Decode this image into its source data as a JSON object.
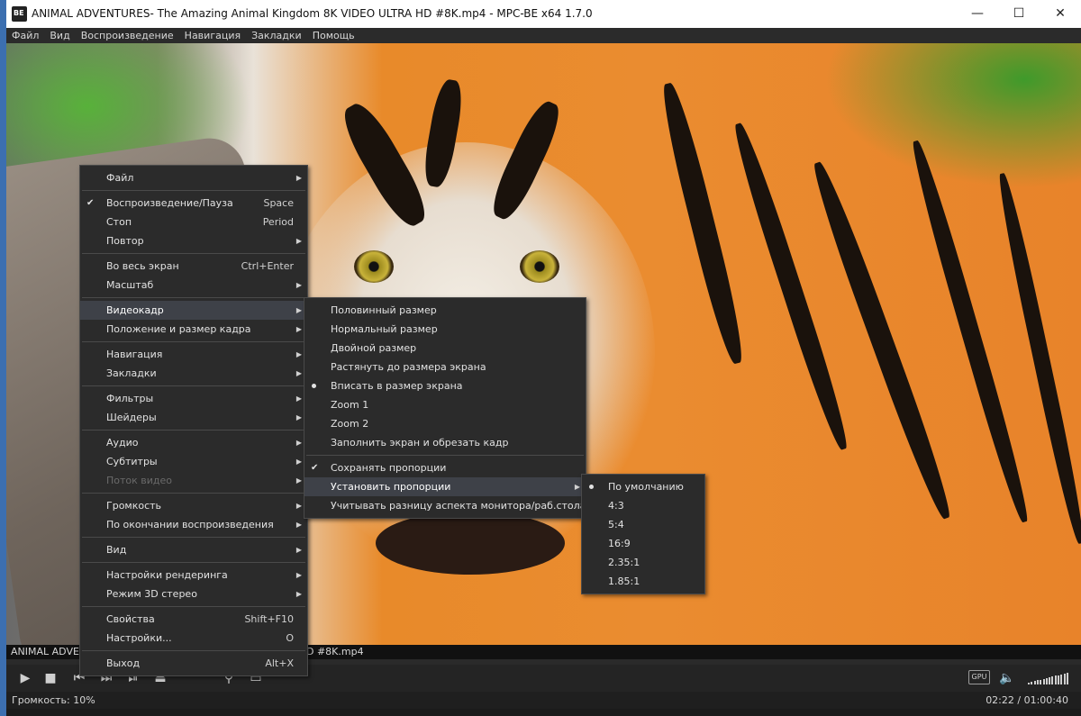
{
  "window": {
    "title": "ANIMAL ADVENTURES- The Amazing Animal Kingdom 8K VIDEO ULTRA HD #8K.mp4 - MPC-BE x64 1.7.0",
    "logo_text": "BE",
    "minimize": "—",
    "maximize": "☐",
    "close": "✕"
  },
  "menubar": [
    "Файл",
    "Вид",
    "Воспроизведение",
    "Навигация",
    "Закладки",
    "Помощь"
  ],
  "overlay": {
    "left_text": "ANIMAL ADVENT",
    "right_text": "D #8K.mp4"
  },
  "controls": {
    "play_icon": "▶",
    "stop_icon": "■",
    "prev_icon": "⏮",
    "next_icon": "⏭",
    "frame_icon": "⏯",
    "eject_icon": "⏏",
    "search_icon": "⚲",
    "misc_icon": "▭",
    "gpu_label": "GPU",
    "volume_icon": "🔈"
  },
  "status": {
    "volume": "Громкость: 10%",
    "time": "02:22 / 01:00:40"
  },
  "context_menu": {
    "items": [
      {
        "label": "Файл",
        "submenu": true
      },
      {
        "sep": true
      },
      {
        "label": "Воспроизведение/Пауза",
        "shortcut": "Space",
        "checked": true
      },
      {
        "label": "Стоп",
        "shortcut": "Period"
      },
      {
        "label": "Повтор",
        "submenu": true
      },
      {
        "sep": true
      },
      {
        "label": "Во весь экран",
        "shortcut": "Ctrl+Enter"
      },
      {
        "label": "Масштаб",
        "submenu": true
      },
      {
        "sep": true
      },
      {
        "label": "Видеокадр",
        "submenu": true,
        "active": true
      },
      {
        "label": "Положение и размер кадра",
        "submenu": true
      },
      {
        "sep": true
      },
      {
        "label": "Навигация",
        "submenu": true
      },
      {
        "label": "Закладки",
        "submenu": true
      },
      {
        "sep": true
      },
      {
        "label": "Фильтры",
        "submenu": true
      },
      {
        "label": "Шейдеры",
        "submenu": true
      },
      {
        "sep": true
      },
      {
        "label": "Аудио",
        "submenu": true
      },
      {
        "label": "Субтитры",
        "submenu": true
      },
      {
        "label": "Поток видео",
        "submenu": true,
        "disabled": true
      },
      {
        "sep": true
      },
      {
        "label": "Громкость",
        "submenu": true
      },
      {
        "label": "По окончании воспроизведения",
        "submenu": true
      },
      {
        "sep": true
      },
      {
        "label": "Вид",
        "submenu": true
      },
      {
        "sep": true
      },
      {
        "label": "Настройки рендеринга",
        "submenu": true
      },
      {
        "label": "Режим 3D стерео",
        "submenu": true
      },
      {
        "sep": true
      },
      {
        "label": "Свойства",
        "shortcut": "Shift+F10"
      },
      {
        "label": "Настройки...",
        "shortcut": "O"
      },
      {
        "sep": true
      },
      {
        "label": "Выход",
        "shortcut": "Alt+X"
      }
    ]
  },
  "videoframe_menu": {
    "items": [
      {
        "label": "Половинный размер"
      },
      {
        "label": "Нормальный размер"
      },
      {
        "label": "Двойной размер"
      },
      {
        "label": "Растянуть до размера экрана"
      },
      {
        "label": "Вписать в размер экрана",
        "radio": true
      },
      {
        "label": "Zoom 1"
      },
      {
        "label": "Zoom 2"
      },
      {
        "label": "Заполнить экран и обрезать кадр"
      },
      {
        "sep": true
      },
      {
        "label": "Сохранять пропорции",
        "checked": true
      },
      {
        "label": "Установить пропорции",
        "submenu": true,
        "active": true
      },
      {
        "label": "Учитывать разницу аспекта монитора/раб.стола"
      }
    ]
  },
  "aspect_menu": {
    "items": [
      {
        "label": "По умолчанию",
        "radio": true
      },
      {
        "label": "4:3"
      },
      {
        "label": "5:4"
      },
      {
        "label": "16:9"
      },
      {
        "label": "2.35:1"
      },
      {
        "label": "1.85:1"
      }
    ]
  },
  "glyphs": {
    "arrow": "▶",
    "check": "✔"
  }
}
